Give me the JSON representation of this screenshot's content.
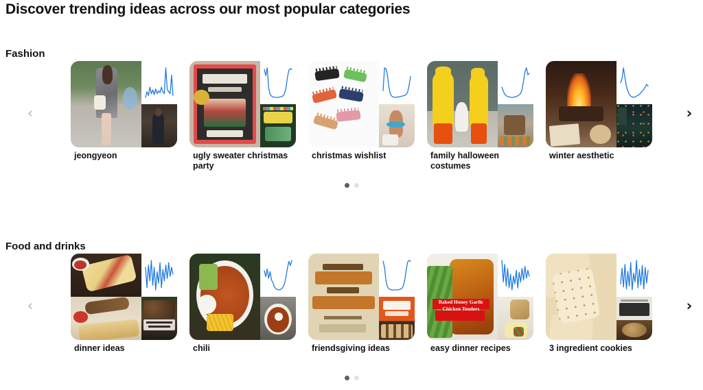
{
  "page": {
    "title": "Discover trending ideas across our most popular categories"
  },
  "sections": [
    {
      "id": "fashion",
      "title": "Fashion",
      "prev_label": "‹",
      "next_label": "›",
      "prev_state": "disabled",
      "next_state": "enabled",
      "pages": 2,
      "active_page": 1,
      "cards": [
        {
          "label": "jeongyeon",
          "hero_art": "street-style-woman",
          "thumb_art": "woman-dark-interior",
          "trend": {
            "type": "line",
            "shape": "volatile-with-spike",
            "values": [
              22,
              34,
              26,
              44,
              30,
              38,
              28,
              40,
              30,
              36,
              32,
              44,
              34,
              30,
              86,
              40,
              34,
              30,
              70,
              26
            ]
          }
        },
        {
          "label": "ugly sweater christmas party",
          "hero_art": "ugly-sweater-photo-frame",
          "thumb_art": "green-chalkboard-poster",
          "trend": {
            "type": "line",
            "shape": "u-curve-seasonal",
            "values": [
              78,
              62,
              82,
              30,
              14,
              9,
              7,
              6,
              6,
              6,
              6,
              7,
              8,
              10,
              16,
              30,
              58,
              76,
              80,
              78
            ]
          }
        },
        {
          "label": "christmas wishlist",
          "hero_art": "hair-claw-clips",
          "thumb_art": "hand-with-bracelet",
          "trend": {
            "type": "line",
            "shape": "early-peak-then-rise",
            "values": [
              30,
              88,
              86,
              70,
              40,
              22,
              16,
              14,
              13,
              13,
              14,
              14,
              15,
              16,
              17,
              18,
              20,
              26,
              44,
              66
            ]
          }
        },
        {
          "label": "family halloween costumes",
          "hero_art": "family-duck-costumes",
          "thumb_art": "porch-pumpkins-family",
          "trend": {
            "type": "line",
            "shape": "late-sharp-rise",
            "values": [
              40,
              30,
              22,
              18,
              16,
              15,
              14,
              14,
              14,
              15,
              16,
              18,
              20,
              24,
              34,
              56,
              80,
              90,
              72,
              76
            ]
          }
        },
        {
          "label": "winter aesthetic",
          "hero_art": "fireplace-cozy",
          "thumb_art": "dark-christmas-tree",
          "trend": {
            "type": "line",
            "shape": "spike-then-u-curve",
            "values": [
              48,
              58,
              84,
              60,
              40,
              28,
              20,
              16,
              14,
              13,
              14,
              16,
              18,
              20,
              24,
              28,
              32,
              38,
              44,
              40
            ]
          }
        }
      ]
    },
    {
      "id": "food-and-drinks",
      "title": "Food and drinks",
      "prev_label": "‹",
      "next_label": "›",
      "prev_state": "disabled",
      "next_state": "enabled",
      "pages": 2,
      "active_page": 1,
      "cards": [
        {
          "label": "dinner ideas",
          "hero_art": "pinwheel-rolls-and-cutting-board",
          "hero_split": true,
          "thumb_art": "garlic-butter-steak-bites",
          "thumb_caption": "Garlic Butter Steak Bites",
          "trend": {
            "type": "line",
            "shape": "noisy-flat-high",
            "values": [
              70,
              52,
              72,
              58,
              76,
              54,
              70,
              50,
              66,
              56,
              74,
              52,
              68,
              58,
              72,
              60,
              74,
              62,
              70,
              64
            ]
          }
        },
        {
          "label": "chili",
          "hero_art": "chili-bowl-avocado-cheese",
          "thumb_art": "chili-bowl-sour-cream",
          "trend": {
            "type": "line",
            "shape": "noisy-dip-then-rise",
            "values": [
              58,
              44,
              62,
              40,
              56,
              36,
              30,
              20,
              16,
              14,
              13,
              14,
              16,
              20,
              28,
              44,
              64,
              80,
              70,
              82
            ]
          }
        },
        {
          "label": "friendsgiving ideas",
          "hero_art": "friendsgiving-turkey-poster",
          "thumb_art": "fall-crostini-bar",
          "trend": {
            "type": "line",
            "shape": "u-curve-seasonal",
            "values": [
              80,
              64,
              30,
              14,
              9,
              7,
              6,
              6,
              6,
              6,
              6,
              7,
              8,
              10,
              16,
              32,
              58,
              78,
              82,
              80
            ]
          }
        },
        {
          "label": "easy dinner recipes",
          "hero_art": "honey-garlic-chicken-tenders",
          "hero_caption": "Baked Honey Garlic Chicken Tenders",
          "thumb_art": "crab-cakes-plate",
          "trend": {
            "type": "line",
            "shape": "noisy-flat-high",
            "values": [
              78,
              56,
              74,
              52,
              70,
              50,
              64,
              48,
              62,
              54,
              68,
              50,
              66,
              56,
              70,
              58,
              72,
              60,
              68,
              62
            ]
          }
        },
        {
          "label": "3 ingredient cookies",
          "hero_art": "shortbread-cookies",
          "thumb_art": "3-ingredient-oatmeal-cookies-label",
          "trend": {
            "type": "line",
            "shape": "very-noisy",
            "values": [
              40,
              72,
              34,
              80,
              30,
              66,
              36,
              84,
              28,
              62,
              44,
              88,
              32,
              70,
              38,
              78,
              30,
              74,
              42,
              68
            ]
          }
        }
      ]
    }
  ]
}
